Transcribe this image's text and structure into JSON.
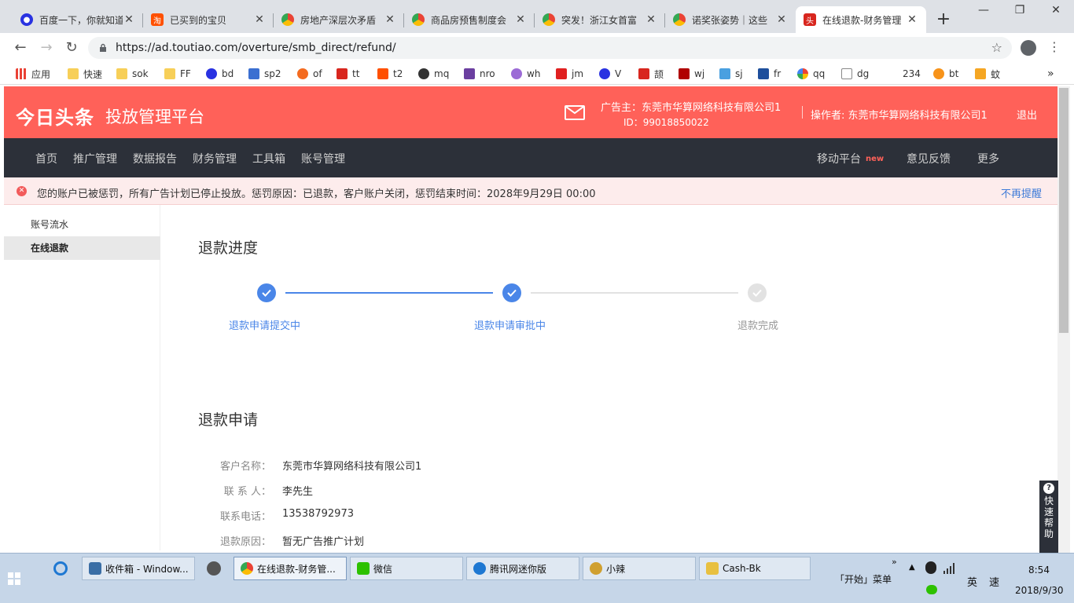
{
  "browser": {
    "tabs": [
      {
        "title": "百度一下，你就知道",
        "icon": "baidu-paw-icon",
        "color": "#2932e1"
      },
      {
        "title": "已买到的宝贝",
        "icon": "taobao-icon",
        "color": "#ff5000"
      },
      {
        "title": "房地产深层次矛盾",
        "icon": "chrome-icon",
        "color": "#34a853"
      },
      {
        "title": "商品房预售制度会",
        "icon": "chrome-icon",
        "color": "#34a853"
      },
      {
        "title": "突发！浙江女首富",
        "icon": "chrome-icon",
        "color": "#34a853"
      },
      {
        "title": "诺奖张姿势｜这些",
        "icon": "chrome-icon",
        "color": "#34a853"
      },
      {
        "title": "在线退款-财务管理",
        "icon": "toutiao-icon",
        "color": "#d8261e"
      }
    ],
    "new_tab": "+",
    "url": "https://ad.toutiao.com/overture/smb_direct/refund/",
    "bookmarks": [
      {
        "label": "应用",
        "icon": "apps-grid-icon",
        "color": "#e94235"
      },
      {
        "label": "快速",
        "icon": "folder-icon",
        "color": "#f7cf58"
      },
      {
        "label": "sok",
        "icon": "folder-icon",
        "color": "#f7cf58"
      },
      {
        "label": "FF",
        "icon": "folder-icon",
        "color": "#f7cf58"
      },
      {
        "label": "bd",
        "icon": "baidu-paw-icon",
        "color": "#2932e1"
      },
      {
        "label": "sp2",
        "icon": "bookmark-icon",
        "color": "#3b6fd1"
      },
      {
        "label": "of",
        "icon": "bookmark-icon",
        "color": "#f46b1f"
      },
      {
        "label": "tt",
        "icon": "bookmark-icon",
        "color": "#d8261e"
      },
      {
        "label": "t2",
        "icon": "taobao-icon",
        "color": "#ff5000"
      },
      {
        "label": "mq",
        "icon": "bookmark-icon",
        "color": "#333333"
      },
      {
        "label": "nro",
        "icon": "bookmark-icon",
        "color": "#6b3fa0"
      },
      {
        "label": "wh",
        "icon": "bookmark-icon",
        "color": "#9c6bd6"
      },
      {
        "label": "jm",
        "icon": "bookmark-icon",
        "color": "#e02020"
      },
      {
        "label": "V",
        "icon": "baidu-paw-icon",
        "color": "#2932e1"
      },
      {
        "label": "颉",
        "icon": "bookmark-icon",
        "color": "#d8261e"
      },
      {
        "label": "wj",
        "icon": "bookmark-icon",
        "color": "#b00000"
      },
      {
        "label": "sj",
        "icon": "bookmark-icon",
        "color": "#4aa0e0"
      },
      {
        "label": "fr",
        "icon": "bookmark-icon",
        "color": "#1e4f9c"
      },
      {
        "label": "qq",
        "icon": "bookmark-icon",
        "color": "#2bb673"
      },
      {
        "label": "dg",
        "icon": "page-icon",
        "color": "#888888"
      },
      {
        "label": "234",
        "icon": "",
        "color": ""
      },
      {
        "label": "bt",
        "icon": "bitcoin-icon",
        "color": "#f7931a"
      },
      {
        "label": "蚊",
        "icon": "bookmark-icon",
        "color": "#f5a623"
      }
    ],
    "bookmarks_more": "»"
  },
  "header": {
    "logo": "今日头条",
    "platform": "投放管理平台",
    "advertiser": "广告主：东莞市华算网络科技有限公司1",
    "advertiser_id": "ID：99018850022",
    "operator": "操作者: 东莞市华算网络科技有限公司1",
    "logout": "退出"
  },
  "nav": {
    "left": [
      "首页",
      "推广管理",
      "数据报告",
      "财务管理",
      "工具箱",
      "账号管理"
    ],
    "mobile": "移动平台",
    "mobile_badge": "new",
    "feedback": "意见反馈",
    "more": "更多"
  },
  "alert": {
    "text": "您的账户已被惩罚，所有广告计划已停止投放。惩罚原因：已退款，客户账户关闭，惩罚结束时间：2028年9月29日 00:00",
    "dismiss": "不再提醒"
  },
  "sidebar": {
    "items": [
      {
        "label": "账号流水",
        "active": false
      },
      {
        "label": "在线退款",
        "active": true
      }
    ]
  },
  "progress": {
    "title": "退款进度",
    "steps": [
      {
        "label": "退款申请提交中",
        "done": true
      },
      {
        "label": "退款申请审批中",
        "done": true
      },
      {
        "label": "退款完成",
        "done": false
      }
    ]
  },
  "application": {
    "title": "退款申请",
    "fields": [
      {
        "label": "客户名称：",
        "value": "东莞市华算网络科技有限公司1"
      },
      {
        "label": "联 系 人：",
        "value": "李先生"
      },
      {
        "label": "联系电话：",
        "value": "13538792973"
      },
      {
        "label": "退款原因：",
        "value": "暂无广告推广计划"
      }
    ]
  },
  "quick_help": "快速帮助",
  "taskbar": {
    "apps": [
      {
        "label": "收件箱 - Window...",
        "color": "#3a6ea5"
      },
      {
        "label": "在线退款-财务管...",
        "color": "#34a853",
        "active": true
      },
      {
        "label": "微信",
        "color": "#2dc100"
      },
      {
        "label": "腾讯网迷你版",
        "color": "#1e78d2"
      },
      {
        "label": "小辣",
        "color": "#d0a030"
      },
      {
        "label": "Cash-Bk",
        "color": "#e8c040"
      }
    ],
    "start_menu": "「开始」菜单",
    "lang": "英",
    "input_mode": "速",
    "time": "8:54",
    "date": "2018/9/30"
  },
  "colors": {
    "brand_red": "#ff6159",
    "nav_dark": "#2c3039",
    "step_blue": "#4a86e8",
    "link_blue": "#3e7bd8"
  }
}
